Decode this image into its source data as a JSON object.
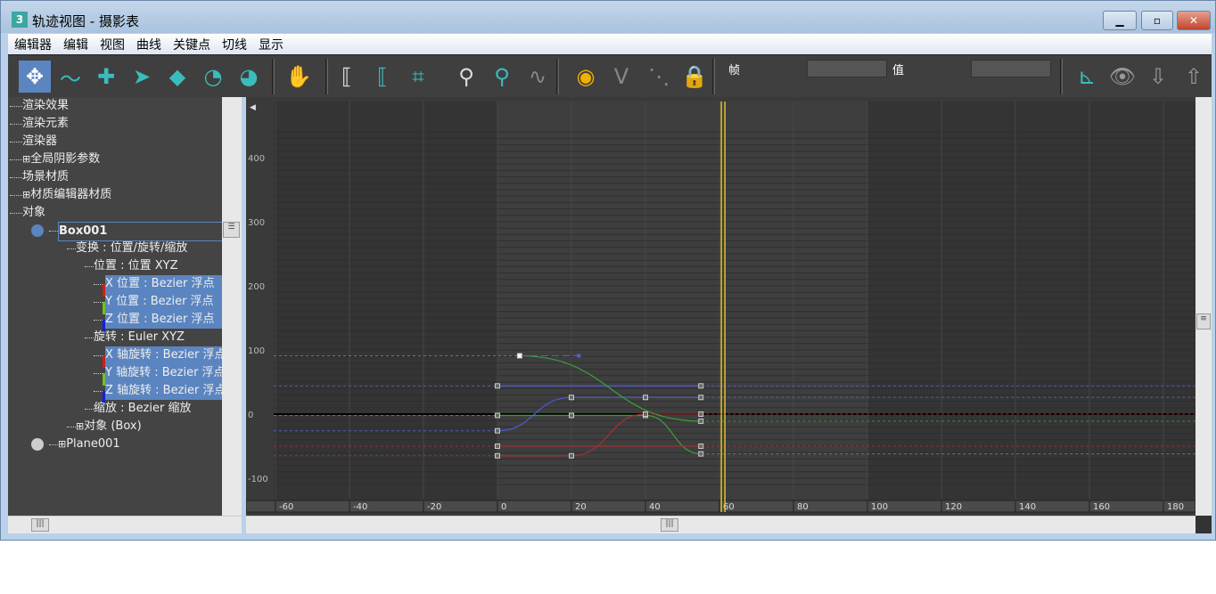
{
  "window": {
    "title": "轨迹视图 - 摄影表",
    "app_icon": "3",
    "minimize": "▁",
    "maximize": "▫",
    "close": "✕"
  },
  "menu": [
    "编辑器",
    "编辑",
    "视图",
    "曲线",
    "关键点",
    "切线",
    "显示"
  ],
  "toolbar": {
    "icons": [
      "move-keys-icon",
      "draw-curves-icon",
      "add-keys-icon",
      "select-region-icon",
      "slide-keys-icon",
      "scale-keys-time-icon",
      "scale-values-icon",
      "pan-icon",
      "frame-horizontal-icon",
      "frame-values-icon",
      "zoom-region-extents-icon",
      "zoom-icon",
      "zoom-region-icon",
      "isolate-curve-icon",
      "show-tangents-icon",
      "flat-tangents-icon",
      "linear-tangents-icon",
      "lock-tangents-icon",
      "frame-icon",
      "filter-icon",
      "snap-down-icon",
      "snap-up-icon"
    ],
    "frame_label": "帧",
    "frame_value": "",
    "value_label": "值",
    "value_value": ""
  },
  "tree": [
    {
      "label": "渲染效果",
      "level": 0
    },
    {
      "label": "渲染元素",
      "level": 0
    },
    {
      "label": "渲染器",
      "level": 0
    },
    {
      "label": "全局阴影参数",
      "level": 0,
      "expand": "+"
    },
    {
      "label": "场景材质",
      "level": 0
    },
    {
      "label": "材质编辑器材质",
      "level": 0,
      "expand": "+"
    },
    {
      "label": "对象",
      "level": 0
    },
    {
      "label": "Box001",
      "level": 1,
      "bold": true
    },
    {
      "label": "变换 : 位置/旋转/缩放",
      "level": 2
    },
    {
      "label": "位置 : 位置 XYZ",
      "level": 3
    },
    {
      "label": "X 位置 : Bezier 浮点",
      "level": 4,
      "selected": true,
      "color": "#d02010"
    },
    {
      "label": "Y 位置 : Bezier 浮点",
      "level": 4,
      "selected": true,
      "color": "#70c020"
    },
    {
      "label": "Z 位置 : Bezier 浮点",
      "level": 4,
      "selected": true,
      "color": "#1020e0"
    },
    {
      "label": "旋转 : Euler XYZ",
      "level": 3
    },
    {
      "label": "X 轴旋转 : Bezier 浮点",
      "level": 4,
      "selected": true,
      "color": "#d02010"
    },
    {
      "label": "Y 轴旋转 : Bezier 浮点",
      "level": 4,
      "selected": true,
      "color": "#70c020"
    },
    {
      "label": "Z 轴旋转 : Bezier 浮点",
      "level": 4,
      "selected": true,
      "color": "#1020e0"
    },
    {
      "label": "缩放 : Bezier 缩放",
      "level": 3
    },
    {
      "label": "对象 (Box)",
      "level": 2,
      "expand": "+"
    },
    {
      "label": "Plane001",
      "level": 1,
      "expand": "+"
    }
  ],
  "chart_data": {
    "type": "line",
    "xlim": [
      -62,
      190
    ],
    "ylim": [
      -110,
      440
    ],
    "x_ticks": [
      -60,
      -40,
      -20,
      0,
      20,
      40,
      60,
      80,
      100,
      120,
      140,
      160,
      180
    ],
    "y_ticks": [
      400,
      300,
      200,
      100,
      0,
      -100
    ],
    "time_slider_frame": 61,
    "series": [
      {
        "color": "#4a58c8",
        "keys": [
          [
            0,
            44
          ],
          [
            55,
            44
          ]
        ]
      },
      {
        "color": "#4a58c8",
        "keys": [
          [
            0,
            -26
          ],
          [
            20,
            26
          ],
          [
            40,
            26
          ],
          [
            55,
            26
          ]
        ]
      },
      {
        "color": "#3a9a3a",
        "keys": [
          [
            0,
            -2
          ],
          [
            20,
            -2
          ],
          [
            40,
            -2
          ],
          [
            55,
            -62
          ]
        ]
      },
      {
        "color": "#a03030",
        "keys": [
          [
            0,
            -65
          ],
          [
            20,
            -65
          ],
          [
            40,
            0
          ],
          [
            55,
            0
          ]
        ]
      },
      {
        "color": "#a03030",
        "keys": [
          [
            0,
            -50
          ],
          [
            55,
            -50
          ]
        ]
      },
      {
        "color": "#3a9a3a",
        "keys": [
          [
            6,
            91
          ],
          [
            55,
            -11
          ]
        ]
      }
    ],
    "tangent_handle": {
      "color": "#5a5ae0",
      "from": [
        6,
        91
      ],
      "to": [
        22,
        91
      ]
    }
  }
}
